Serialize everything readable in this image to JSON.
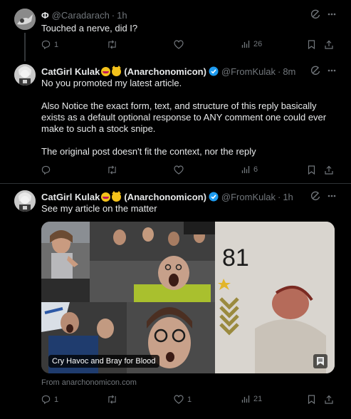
{
  "colors": {
    "background": "#000000",
    "text": "#e7e9ea",
    "muted": "#71767b",
    "divider": "#2f3336",
    "verified": "#1d9bf0"
  },
  "posts": [
    {
      "name": "Φ",
      "handle": "@Caradarach",
      "time": "1h",
      "verified": false,
      "text": [
        "Touched a nerve, did I?"
      ],
      "replies": "1",
      "reposts": "",
      "likes": "",
      "views": "26"
    },
    {
      "name": "CatGirl Kulak",
      "name_suffix": "(Anarchonomicon)",
      "handle": "@FromKulak",
      "time": "8m",
      "verified": true,
      "text": [
        "No you promoted my latest article.",
        "Also Notice the exact form, text, and structure of this reply basically exists as a default optional response to ANY comment one could ever make to such a stock snipe.",
        "The original post doesn't fit the context, nor the reply"
      ],
      "replies": "",
      "reposts": "",
      "likes": "",
      "views": "6"
    },
    {
      "name": "CatGirl Kulak",
      "name_suffix": "(Anarchonomicon)",
      "handle": "@FromKulak",
      "time": "1h",
      "verified": true,
      "text": [
        "See my article on the matter"
      ],
      "card": {
        "caption": "Cry Havoc and Bray for Blood",
        "source": "From anarchonomicon.com",
        "image_number": "81"
      },
      "replies": "1",
      "reposts": "",
      "likes": "1",
      "views": "21"
    }
  ],
  "icons": {
    "grok": "grok-icon",
    "more": "more-icon",
    "reply": "reply-icon",
    "repost": "repost-icon",
    "like": "like-icon",
    "views": "views-icon",
    "bookmark": "bookmark-icon",
    "share": "share-icon"
  }
}
